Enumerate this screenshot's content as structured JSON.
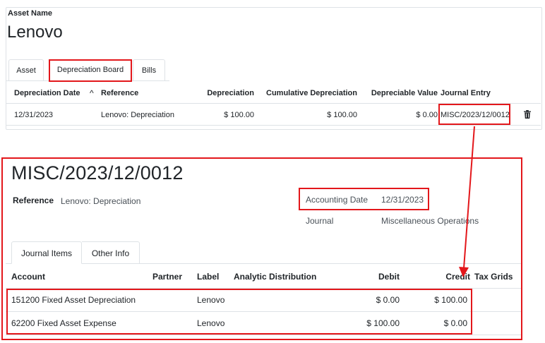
{
  "asset": {
    "label": "Asset Name",
    "name": "Lenovo",
    "tabs": [
      "Asset",
      "Depreciation Board",
      "Bills"
    ],
    "columns": {
      "date": "Depreciation Date",
      "sort_icon": "^",
      "reference": "Reference",
      "depreciation": "Depreciation",
      "cumulative": "Cumulative Depreciation",
      "depreciable": "Depreciable Value",
      "journal_entry": "Journal Entry"
    },
    "row": {
      "date": "12/31/2023",
      "reference": "Lenovo: Depreciation",
      "depreciation": "$ 100.00",
      "cumulative": "$ 100.00",
      "depreciable": "$ 0.00",
      "journal_entry": "MISC/2023/12/0012"
    }
  },
  "entry": {
    "title": "MISC/2023/12/0012",
    "reference_label": "Reference",
    "reference_value": "Lenovo: Depreciation",
    "accounting_date_label": "Accounting Date",
    "accounting_date_value": "12/31/2023",
    "journal_label": "Journal",
    "journal_value": "Miscellaneous Operations",
    "tabs": [
      "Journal Items",
      "Other Info"
    ],
    "columns": {
      "account": "Account",
      "partner": "Partner",
      "label": "Label",
      "analytic": "Analytic Distribution",
      "debit": "Debit",
      "credit": "Credit",
      "tax": "Tax Grids"
    },
    "lines": [
      {
        "account": "151200 Fixed Asset Depreciation",
        "label": "Lenovo",
        "debit": "$ 0.00",
        "credit": "$ 100.00"
      },
      {
        "account": "62200 Fixed Asset Expense",
        "label": "Lenovo",
        "debit": "$ 100.00",
        "credit": "$ 0.00"
      }
    ]
  },
  "colors": {
    "highlight": "#e3171b",
    "border": "#dee2e6",
    "text": "#212529"
  }
}
